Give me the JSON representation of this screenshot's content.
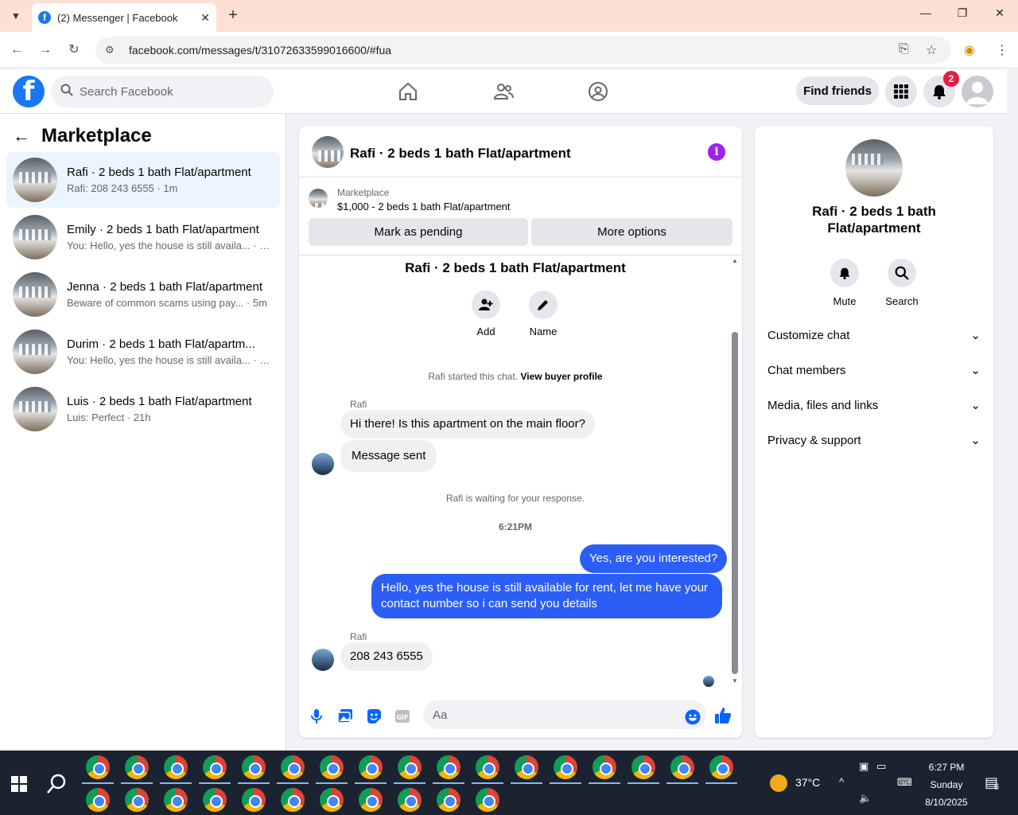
{
  "browser": {
    "tab_title": "(2) Messenger | Facebook",
    "url": "facebook.com/messages/t/31072633599016600/#fua"
  },
  "fb": {
    "search_placeholder": "Search Facebook",
    "find_friends": "Find friends",
    "notification_count": "2",
    "brand_color": "#1877f2"
  },
  "left": {
    "title": "Marketplace",
    "conversations": [
      {
        "name": "Rafi · 2 beds 1 bath Flat/apartment",
        "preview": "Rafi: 208 243 6555 · 1m",
        "active": true
      },
      {
        "name": "Emily · 2 beds 1 bath Flat/apartment",
        "preview": "You: Hello, yes the house is still availa... · 5m"
      },
      {
        "name": "Jenna · 2 beds 1 bath Flat/apartment",
        "preview": "Beware of common scams using pay... · 5m"
      },
      {
        "name": "Durim · 2 beds 1 bath Flat/apartm...",
        "preview": "You: Hello, yes the house is still availa... · 5m"
      },
      {
        "name": "Luis · 2 beds 1 bath Flat/apartment",
        "preview": "Luis: Perfect · 21h"
      }
    ]
  },
  "chat": {
    "title": "Rafi · 2 beds 1 bath Flat/apartment",
    "listing_label": "Marketplace",
    "listing_price": "$1,000 - 2 beds 1 bath Flat/apartment",
    "mark_pending": "Mark as pending",
    "more_options": "More options",
    "body_title": "Rafi · 2 beds 1 bath Flat/apartment",
    "add_label": "Add",
    "name_label": "Name",
    "started_text": "Rafi started this chat.",
    "view_profile": "View buyer profile",
    "sender1": "Rafi",
    "msg1": "Hi there! Is this apartment on the main floor?",
    "msg2": "Message sent",
    "waiting": "Rafi is waiting for your response.",
    "time": "6:21PM",
    "msg3": "Yes, are you interested?",
    "msg4": "Hello, yes the house is still available for rent, let me have your contact number so i can send you details",
    "sender2": "Rafi",
    "msg5": "208 243 6555",
    "composer_placeholder": "Aa",
    "outgoing_color": "#2c5ef6"
  },
  "right": {
    "title": "Rafi · 2 beds 1 bath Flat/apartment",
    "mute": "Mute",
    "search": "Search",
    "sections": [
      "Customize chat",
      "Chat members",
      "Media, files and links",
      "Privacy & support"
    ]
  },
  "taskbar": {
    "temperature": "37°C",
    "time": "6:27 PM",
    "day": "Sunday",
    "date": "8/10/2025",
    "notifications": "6"
  }
}
